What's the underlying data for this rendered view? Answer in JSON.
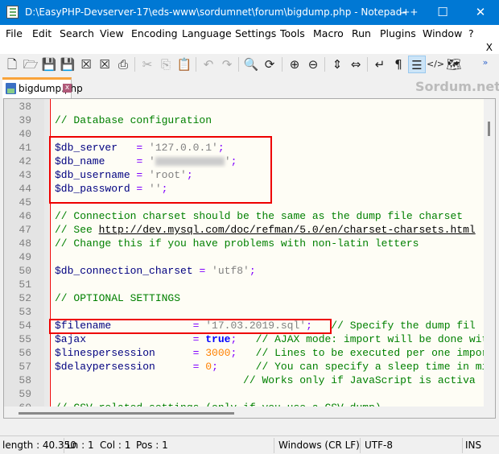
{
  "window": {
    "title": "D:\\EasyPHP-Devserver-17\\eds-www\\sordumnet\\forum\\bigdump.php - Notepad++",
    "minimize": "–",
    "maximize": "☐",
    "close": "✕"
  },
  "menu": [
    "File",
    "Edit",
    "Search",
    "View",
    "Encoding",
    "Language",
    "Settings",
    "Tools",
    "Macro",
    "Run",
    "Plugins",
    "Window",
    "?"
  ],
  "menu_close": "X",
  "toolbar": [
    {
      "icon": "new-file-icon",
      "g": "🗋"
    },
    {
      "icon": "open-folder-icon",
      "g": "🗁"
    },
    {
      "icon": "save-icon",
      "g": "💾",
      "dis": true
    },
    {
      "icon": "save-all-icon",
      "g": "💾",
      "dis": true
    },
    {
      "icon": "close-icon",
      "g": "☒"
    },
    {
      "icon": "close-all-icon",
      "g": "☒"
    },
    {
      "icon": "print-icon",
      "g": "⎙"
    },
    {
      "icon": "cut-icon",
      "g": "✂",
      "dis": true
    },
    {
      "icon": "copy-icon",
      "g": "⎘",
      "dis": true
    },
    {
      "icon": "paste-icon",
      "g": "📋",
      "dis": true
    },
    {
      "icon": "undo-icon",
      "g": "↶",
      "dis": true
    },
    {
      "icon": "redo-icon",
      "g": "↷",
      "dis": true
    },
    {
      "icon": "find-icon",
      "g": "🔍"
    },
    {
      "icon": "replace-icon",
      "g": "⟳"
    },
    {
      "icon": "zoom-in-icon",
      "g": "⊕"
    },
    {
      "icon": "zoom-out-icon",
      "g": "⊖"
    },
    {
      "icon": "sync-vertical-icon",
      "g": "⇕"
    },
    {
      "icon": "sync-horizontal-icon",
      "g": "⇔"
    },
    {
      "icon": "word-wrap-icon",
      "g": "↵"
    },
    {
      "icon": "show-all-chars-icon",
      "g": "¶"
    },
    {
      "icon": "indent-guide-icon",
      "g": "☰",
      "active": true
    },
    {
      "icon": "xml-tag-icon",
      "g": "</>"
    },
    {
      "icon": "document-map-icon",
      "g": "🗺"
    }
  ],
  "toolbar_overflow": "»",
  "tab": {
    "label": "bigdump.php",
    "close": "x"
  },
  "watermark": "Sordum.net",
  "lines": [
    {
      "n": "38",
      "t": []
    },
    {
      "n": "39",
      "t": [
        [
          "cmt",
          "// Database configuration"
        ]
      ]
    },
    {
      "n": "40",
      "t": []
    },
    {
      "n": "41",
      "t": [
        [
          "var",
          "$db_server"
        ],
        [
          "",
          "   "
        ],
        [
          "op",
          "="
        ],
        [
          "",
          ""
        ],
        [
          "str",
          " '127.0.0.1'"
        ],
        [
          "op",
          ";"
        ]
      ]
    },
    {
      "n": "42",
      "t": [
        [
          "var",
          "$db_name"
        ],
        [
          "",
          "     "
        ],
        [
          "op",
          "="
        ],
        [
          "str",
          " '"
        ],
        [
          "blur",
          ""
        ],
        [
          "str",
          "'"
        ],
        [
          "op",
          ";"
        ]
      ]
    },
    {
      "n": "43",
      "t": [
        [
          "var",
          "$db_username"
        ],
        [
          "op",
          " ="
        ],
        [
          "str",
          " 'root'"
        ],
        [
          "op",
          ";"
        ]
      ]
    },
    {
      "n": "44",
      "t": [
        [
          "var",
          "$db_password"
        ],
        [
          "op",
          " ="
        ],
        [
          "str",
          " ''"
        ],
        [
          "op",
          ";"
        ]
      ]
    },
    {
      "n": "45",
      "t": []
    },
    {
      "n": "46",
      "t": [
        [
          "cmt",
          "// Connection charset should be the same as the dump file charset"
        ]
      ]
    },
    {
      "n": "47",
      "t": [
        [
          "cmt",
          "// See "
        ],
        [
          "url",
          "http://dev.mysql.com/doc/refman/5.0/en/charset-charsets.html"
        ]
      ]
    },
    {
      "n": "48",
      "t": [
        [
          "cmt",
          "// Change this if you have problems with non-latin letters"
        ]
      ]
    },
    {
      "n": "49",
      "t": []
    },
    {
      "n": "50",
      "t": [
        [
          "var",
          "$db_connection_charset"
        ],
        [
          "op",
          " ="
        ],
        [
          "str",
          " 'utf8'"
        ],
        [
          "op",
          ";"
        ]
      ]
    },
    {
      "n": "51",
      "t": []
    },
    {
      "n": "52",
      "t": [
        [
          "cmt",
          "// OPTIONAL SETTINGS"
        ]
      ]
    },
    {
      "n": "53",
      "t": []
    },
    {
      "n": "54",
      "t": [
        [
          "var",
          "$filename"
        ],
        [
          "",
          "             "
        ],
        [
          "op",
          "="
        ],
        [
          "str",
          " '17.03.2019.sql'"
        ],
        [
          "op",
          ";"
        ],
        [
          "cmt",
          "   // Specify the dump fil"
        ]
      ]
    },
    {
      "n": "55",
      "t": [
        [
          "var",
          "$ajax"
        ],
        [
          "",
          "                 "
        ],
        [
          "op",
          "="
        ],
        [
          "kw",
          " true"
        ],
        [
          "op",
          ";"
        ],
        [
          "cmt",
          "   // AJAX mode: import will be done wit"
        ]
      ]
    },
    {
      "n": "56",
      "t": [
        [
          "var",
          "$linespersession"
        ],
        [
          "",
          "      "
        ],
        [
          "op",
          "="
        ],
        [
          "num",
          " 3000"
        ],
        [
          "op",
          ";"
        ],
        [
          "cmt",
          "   // Lines to be executed per one impor"
        ]
      ]
    },
    {
      "n": "57",
      "t": [
        [
          "var",
          "$delaypersession"
        ],
        [
          "",
          "      "
        ],
        [
          "op",
          "="
        ],
        [
          "num",
          " 0"
        ],
        [
          "op",
          ";"
        ],
        [
          "cmt",
          "      // You can specify a sleep time in mi"
        ]
      ]
    },
    {
      "n": "58",
      "t": [
        [
          "",
          "                              "
        ],
        [
          "cmt",
          "// Works only if JavaScript is activa"
        ]
      ]
    },
    {
      "n": "59",
      "t": []
    },
    {
      "n": "60",
      "t": [
        [
          "cmt",
          "// CSV related settings (only if you use a CSV dump)"
        ]
      ]
    }
  ],
  "status": {
    "length": "length : 40.350",
    "ln": "Ln : 1",
    "col": "Col : 1",
    "pos": "Pos : 1",
    "eol": "Windows (CR LF)",
    "encoding": "UTF-8",
    "mode": "INS"
  }
}
